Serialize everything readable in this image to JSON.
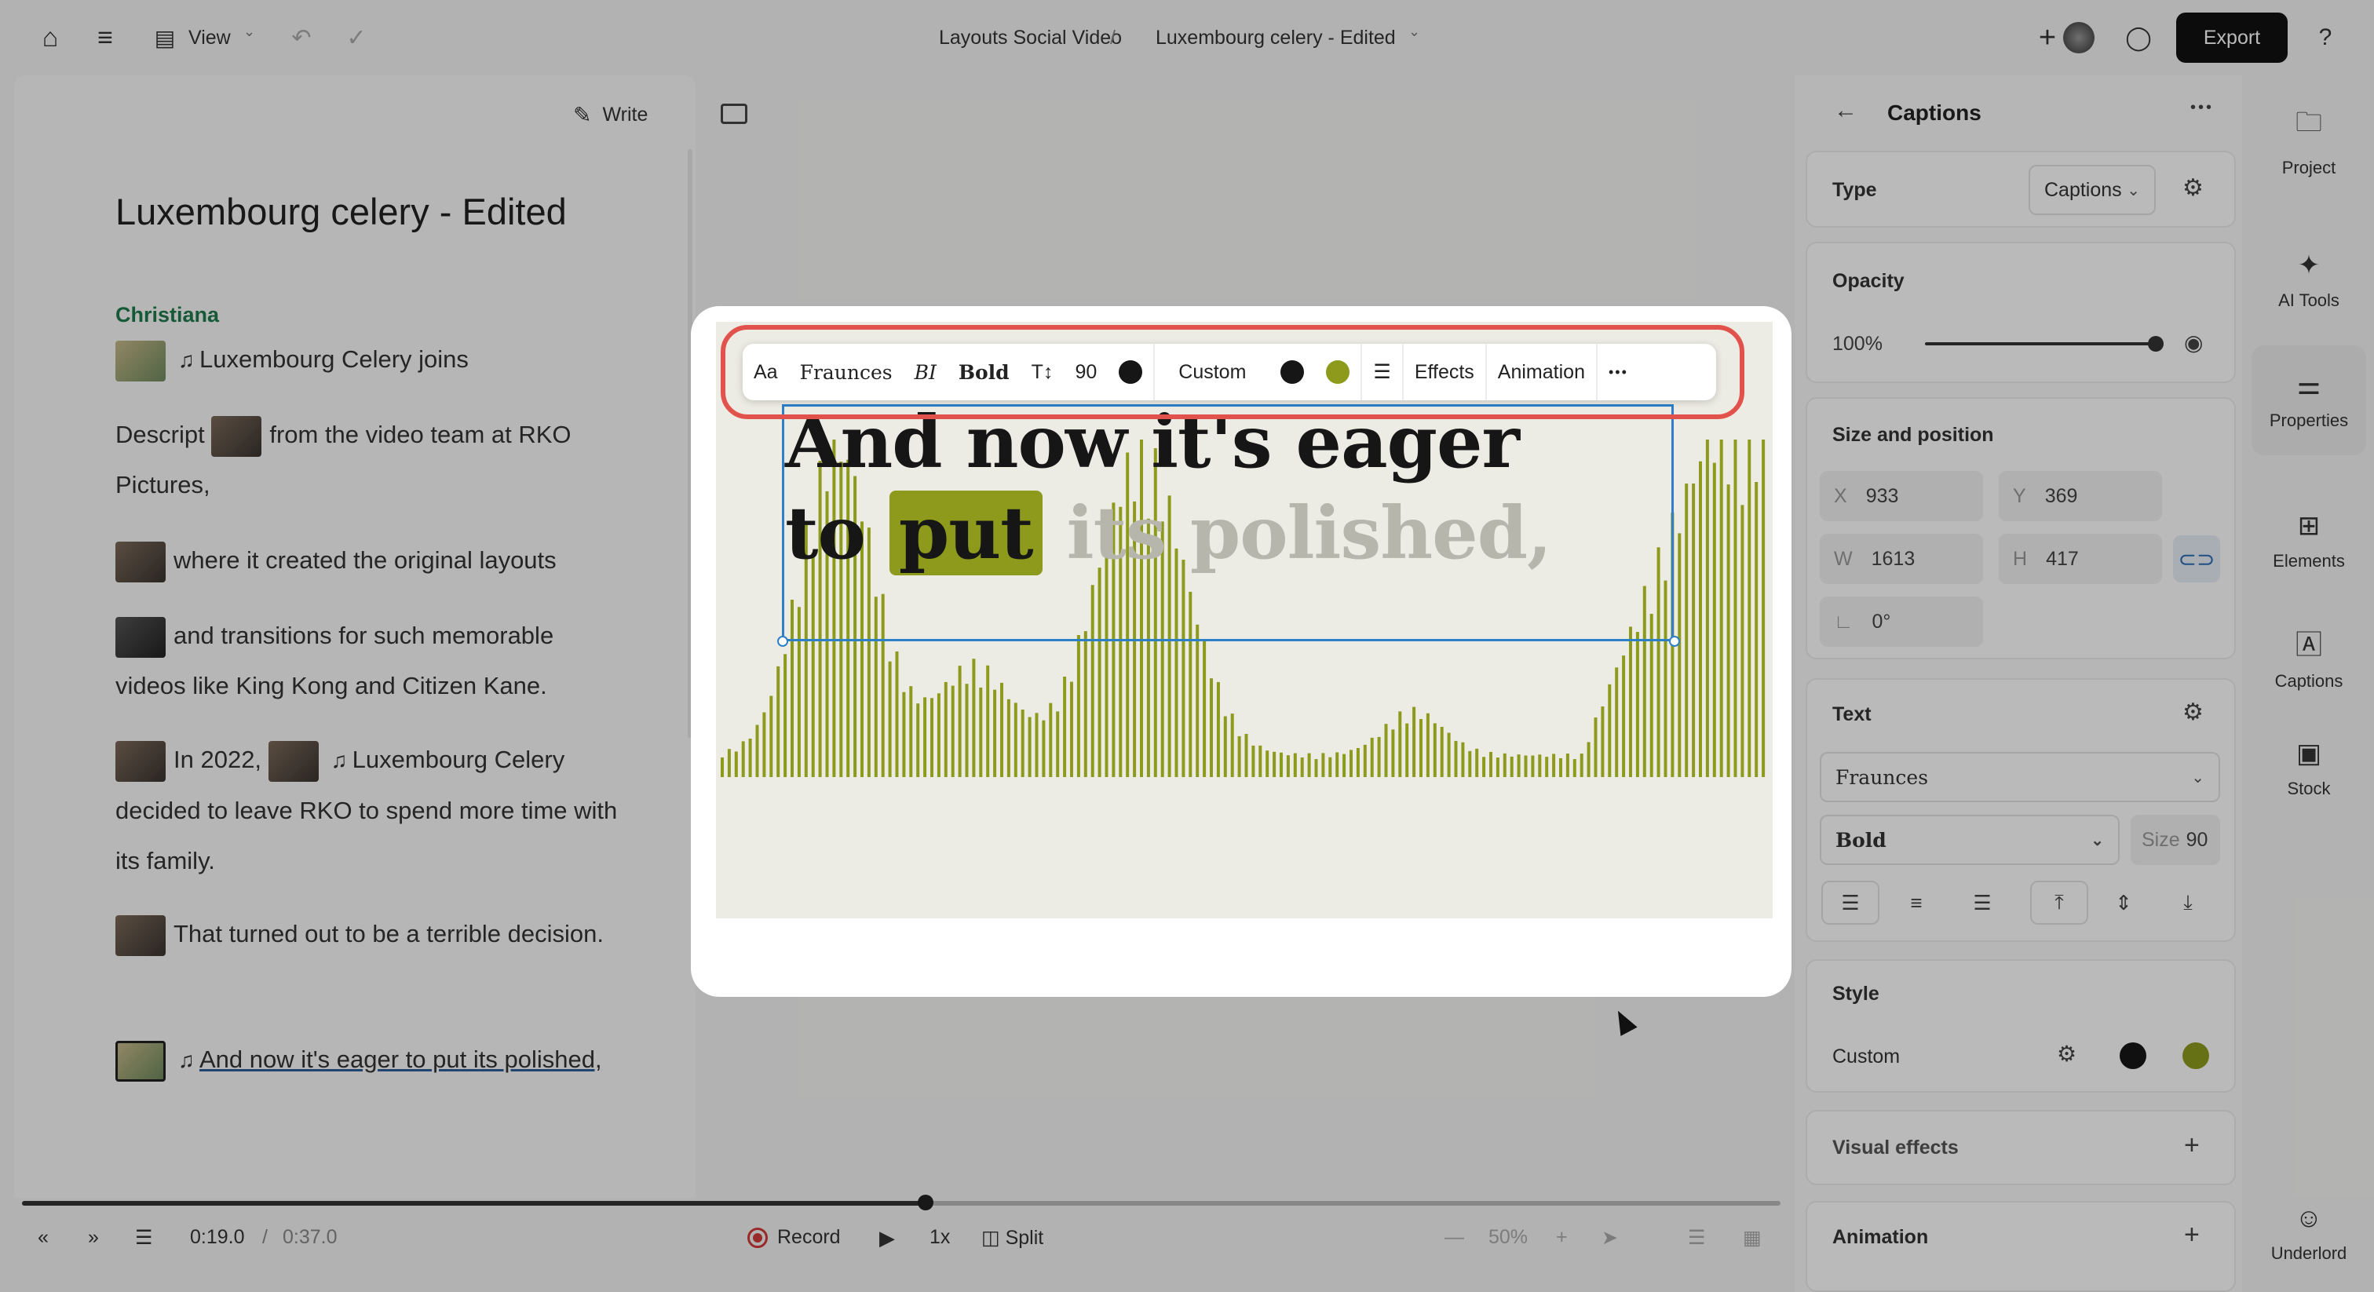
{
  "topbar": {
    "view_label": "View",
    "breadcrumb_project": "Layouts Social Video",
    "breadcrumb_sep": "/",
    "breadcrumb_doc": "Luxembourg celery - Edited",
    "export_label": "Export"
  },
  "script": {
    "write_label": "Write",
    "title": "Luxembourg celery - Edited",
    "speaker": "Christiana",
    "paragraphs": [
      "Luxembourg Celery joins",
      "Descript",
      "from the video team at RKO Pictures,",
      "where it created the original layouts",
      "and transitions for such memorable videos like King Kong and Citizen Kane.",
      "In 2022,",
      "Luxembourg Celery decided to leave RKO to spend more time with its family.",
      "That turned out to be a terrible decision.",
      "And now it's eager to put its polished,"
    ]
  },
  "caption": {
    "line1": "And now it's eager",
    "line2_word1": "to",
    "line2_highlight": "put",
    "line2_rest": "its polished,"
  },
  "toolbar": {
    "aa": "Aa",
    "font": "Fraunces",
    "bi": "BI",
    "weight": "Bold",
    "size_icon": "T↕",
    "size": "90",
    "style_label": "Custom",
    "effects": "Effects",
    "animation": "Animation",
    "more": "•••"
  },
  "panel": {
    "title": "Captions",
    "type_label": "Type",
    "type_value": "Captions",
    "opacity_label": "Opacity",
    "opacity_value": "100%",
    "opacity_fraction": 1.0,
    "size_pos_label": "Size and position",
    "x_key": "X",
    "x_value": "933",
    "y_key": "Y",
    "y_value": "369",
    "w_key": "W",
    "w_value": "1613",
    "h_key": "H",
    "h_value": "417",
    "rotation_value": "0°",
    "text_label": "Text",
    "font_value": "Fraunces",
    "weight_value": "Bold",
    "size_key": "Size",
    "size_value": "90",
    "style_label": "Style",
    "style_value": "Custom",
    "visual_effects_label": "Visual effects",
    "animation_label": "Animation"
  },
  "nav": {
    "project": "Project",
    "ai_tools": "AI Tools",
    "properties": "Properties",
    "elements": "Elements",
    "captions": "Captions",
    "stock": "Stock",
    "underlord": "Underlord"
  },
  "transport": {
    "current_time": "0:19.0",
    "time_sep": "/",
    "total_time": "0:37.0",
    "record_label": "Record",
    "speed": "1x",
    "split_label": "Split",
    "zoom": "50%",
    "progress_fraction": 0.514
  },
  "colors": {
    "accent_olive": "#8d9a1c",
    "highlight_red": "#e2524c",
    "selection_blue": "#2d7fc8",
    "dark": "#161616"
  }
}
